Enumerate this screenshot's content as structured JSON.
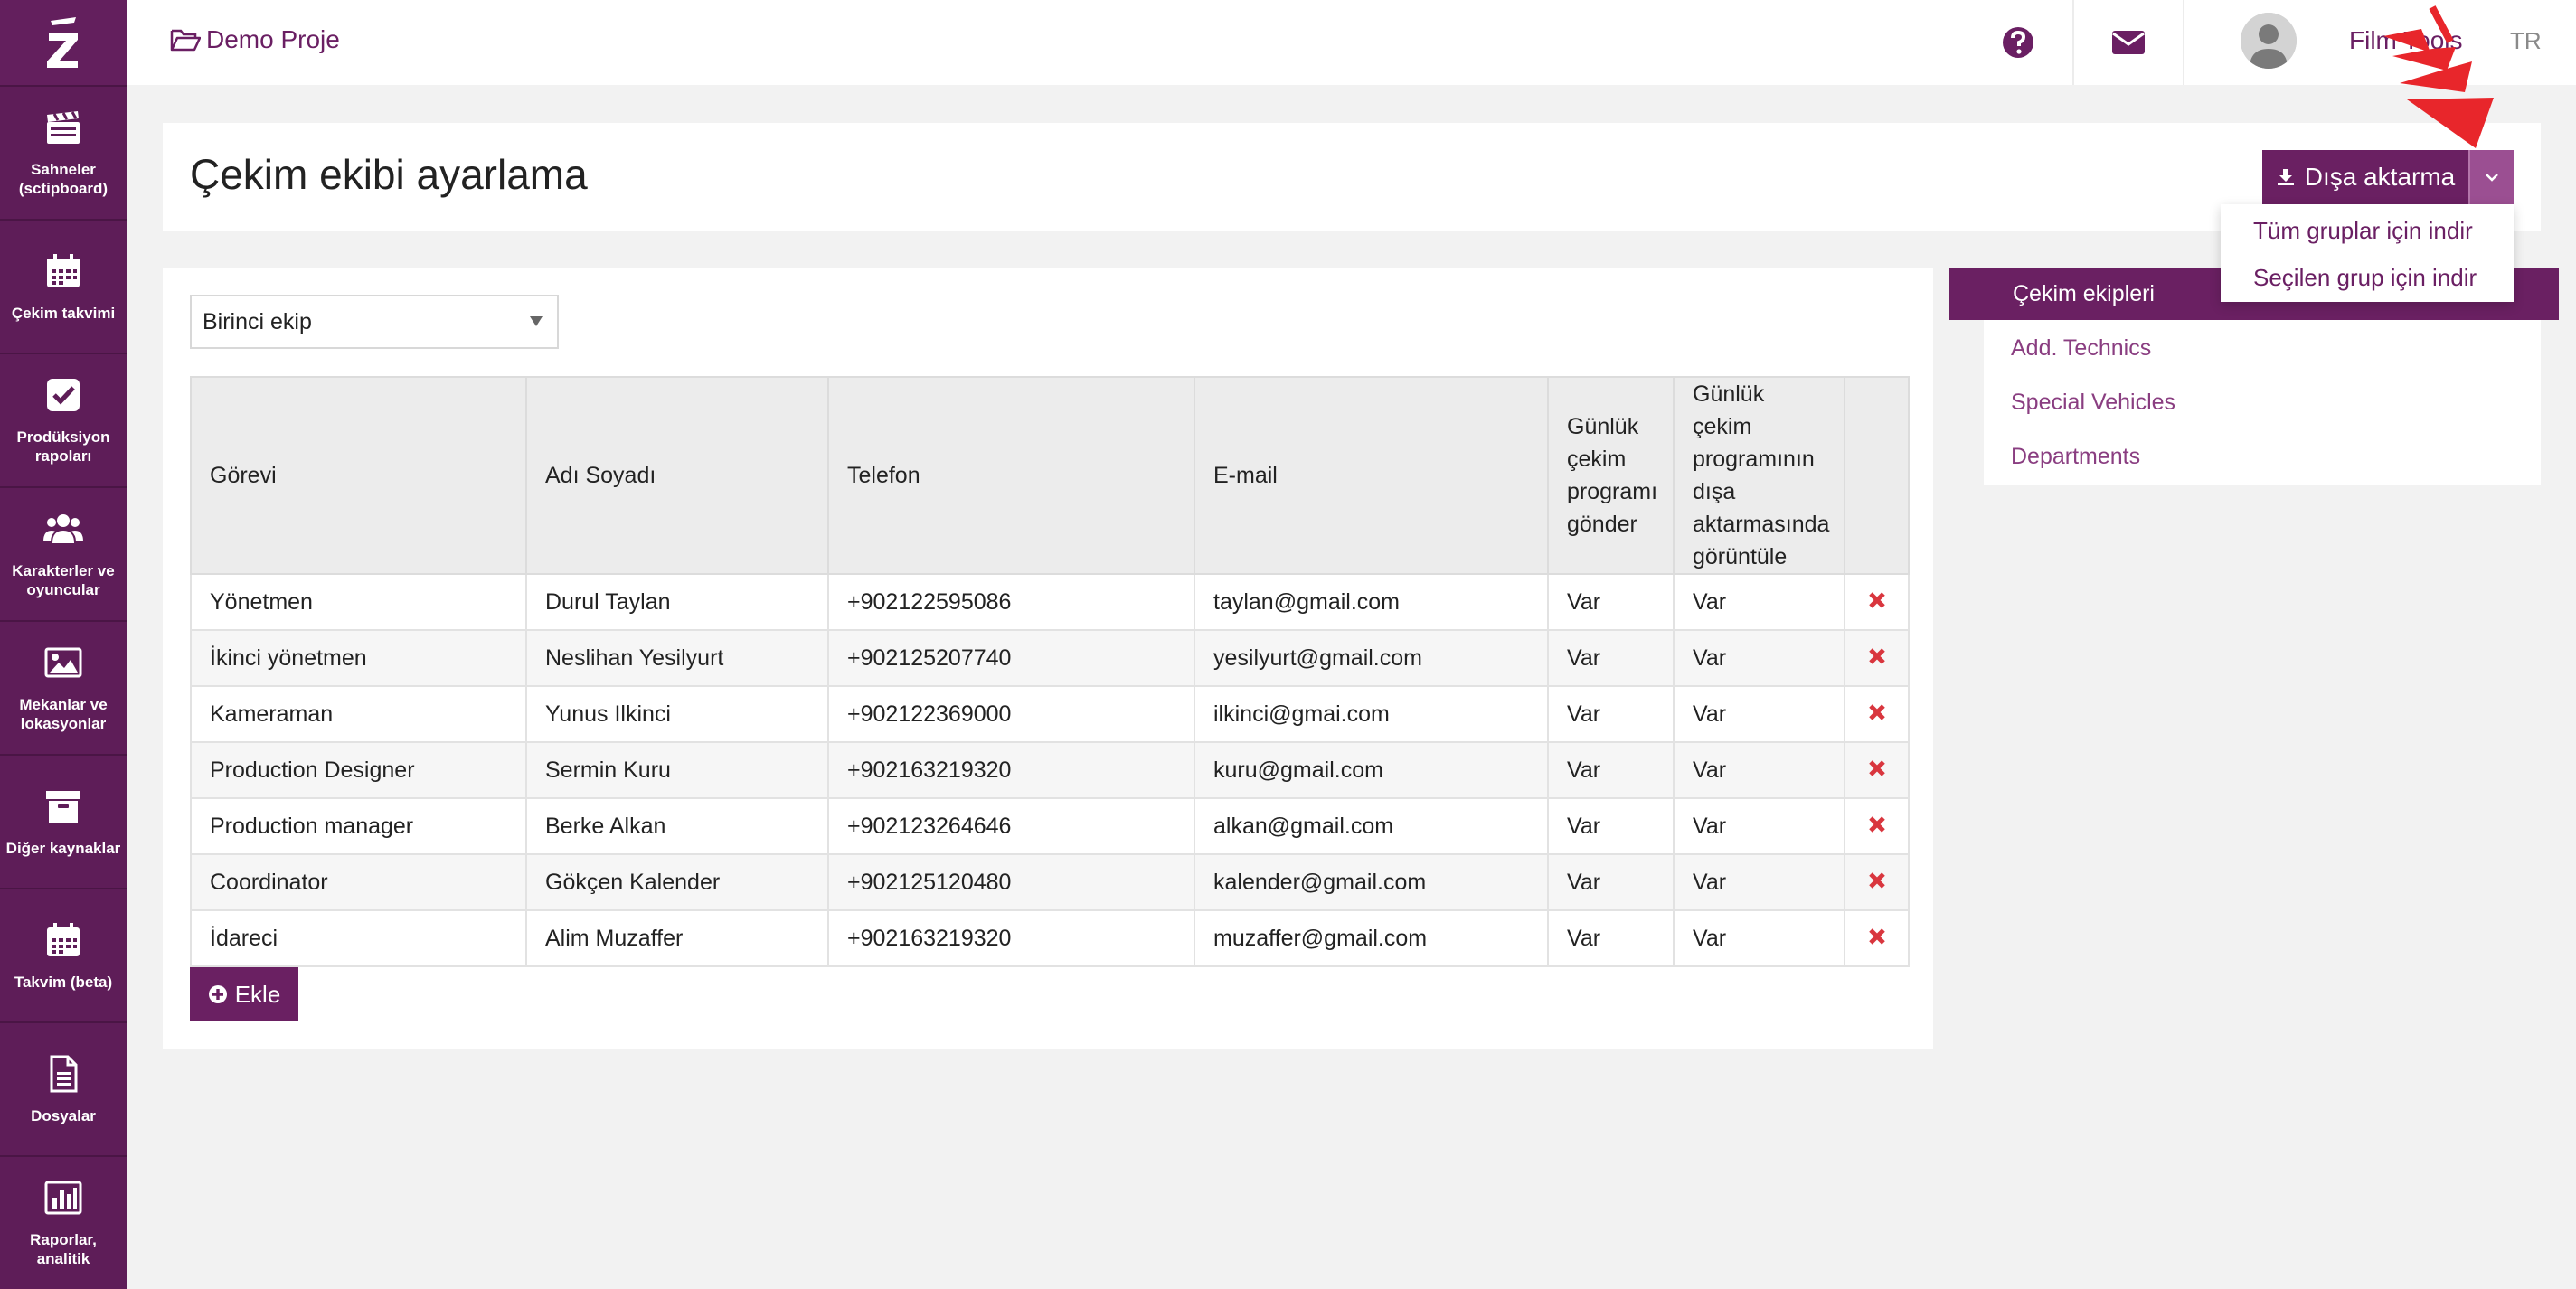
{
  "sidebar": {
    "items": [
      {
        "label": "Sahneler (sctipboard)",
        "icon": "clapperboard-icon"
      },
      {
        "label": "Çekim takvimi",
        "icon": "calendar-icon"
      },
      {
        "label": "Prodüksiyon rapoları",
        "icon": "checkbox-icon"
      },
      {
        "label": "Karakterler ve oyuncular",
        "icon": "users-icon"
      },
      {
        "label": "Mekanlar ve lokasyonlar",
        "icon": "image-icon"
      },
      {
        "label": "Diğer kaynaklar",
        "icon": "archive-icon"
      },
      {
        "label": "Takvim (beta)",
        "icon": "calendar-icon"
      },
      {
        "label": "Dosyalar",
        "icon": "file-icon"
      },
      {
        "label": "Raporlar, analitik",
        "icon": "bar-chart-icon"
      }
    ]
  },
  "topbar": {
    "project": "Demo Proje",
    "user_name": "Film Tools",
    "language": "TR"
  },
  "header": {
    "title": "Çekim ekibi ayarlama",
    "export_label": "Dışa aktarma",
    "export_menu": [
      "Tüm gruplar için indir",
      "Seçilen grup için indir"
    ]
  },
  "crew": {
    "selected_group": "Birinci ekip",
    "columns": [
      "Görevi",
      "Adı Soyadı",
      "Telefon",
      "E-mail",
      "Günlük çekim programı gönder",
      "Günlük çekim programının dışa aktarmasında görüntüle"
    ],
    "rows": [
      [
        "Yönetmen",
        "Durul Taylan",
        "+902122595086",
        "taylan@gmail.com",
        "Var",
        "Var"
      ],
      [
        "İkinci yönetmen",
        "Neslihan Yesilyurt",
        "+902125207740",
        "yesilyurt@gmail.com",
        "Var",
        "Var"
      ],
      [
        "Kameraman",
        "Yunus Ilkinci",
        "+902122369000",
        "ilkinci@gmai.com",
        "Var",
        "Var"
      ],
      [
        "Production Designer",
        "Sermin Kuru",
        "+902163219320",
        "kuru@gmail.com",
        "Var",
        "Var"
      ],
      [
        "Production manager",
        "Berke Alkan",
        "+902123264646",
        "alkan@gmail.com",
        "Var",
        "Var"
      ],
      [
        "Coordinator",
        "Gökçen Kalender",
        "+902125120480",
        "kalender@gmail.com",
        "Var",
        "Var"
      ],
      [
        "İdareci",
        "Alim Muzaffer",
        "+902163219320",
        "muzaffer@gmail.com",
        "Var",
        "Var"
      ]
    ],
    "add_label": "Ekle"
  },
  "right_nav": {
    "items": [
      "Çekim ekipleri",
      "Add. Technics",
      "Special Vehicles",
      "Departments"
    ]
  },
  "colors": {
    "brand": "#6a2062",
    "sidebar": "#5e1d58",
    "delete": "#d9363e",
    "annotation_arrow": "#e8262b"
  }
}
